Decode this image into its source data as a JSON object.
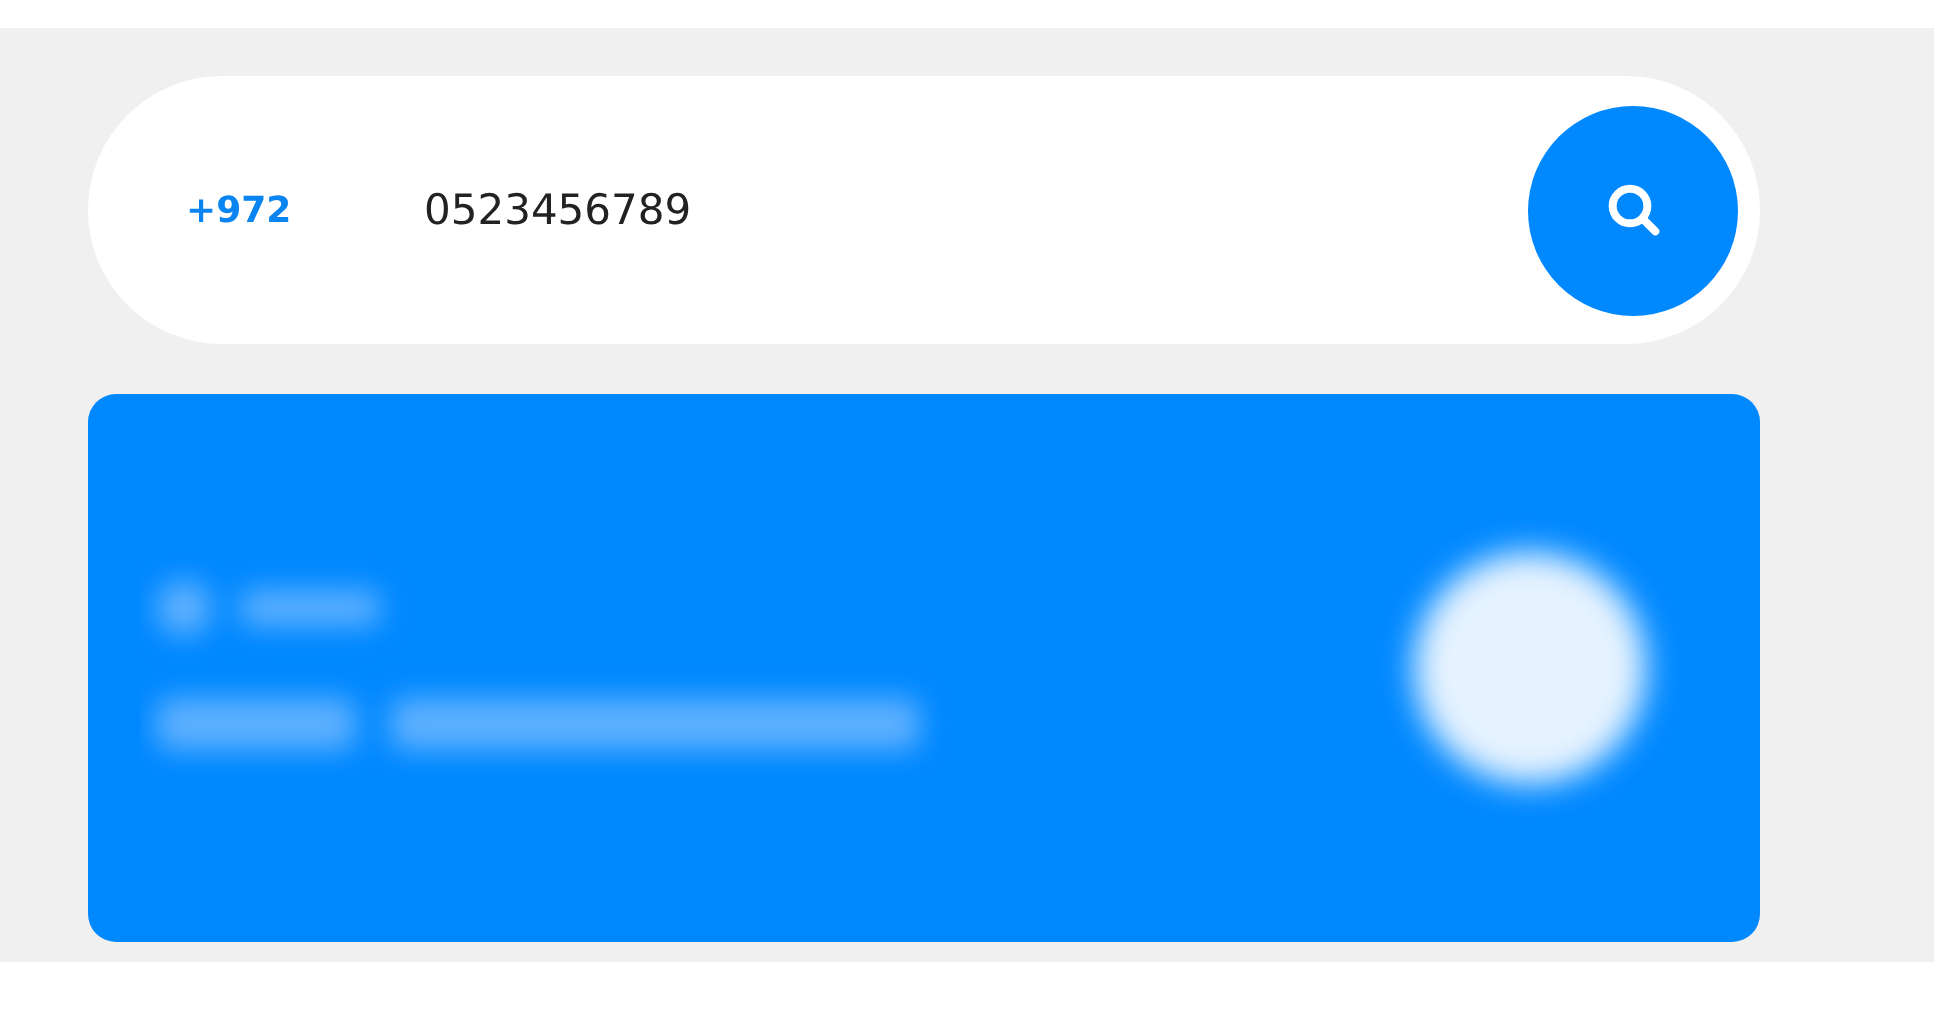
{
  "search": {
    "country_code": "+972",
    "value": "0523456789"
  },
  "result_card": {
    "kind": "blurred"
  }
}
